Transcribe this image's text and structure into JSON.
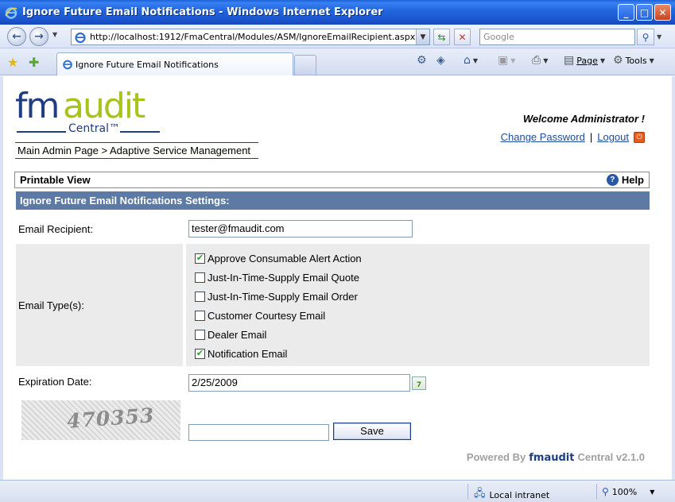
{
  "window": {
    "title": "Ignore Future Email Notifications - Windows Internet Explorer",
    "minimize_icon": "minimize-icon",
    "maximize_icon": "maximize-icon",
    "close_icon": "close-icon"
  },
  "addressbar": {
    "url": "http://localhost:1912/FmaCentral/Modules/ASM/IgnoreEmailRecipient.aspx?EmailID=",
    "search_placeholder": "Google"
  },
  "tabs": [
    {
      "label": "Ignore Future Email Notifications"
    }
  ],
  "commandbar": {
    "page_label": "Page",
    "tools_label": "Tools"
  },
  "header": {
    "logo_fm": "fm",
    "logo_audit": "audit",
    "logo_central": "Central™",
    "welcome": "Welcome Administrator !",
    "change_password": "Change Password",
    "separator": "|",
    "logout": "Logout",
    "breadcrumb": "Main Admin Page  >  Adaptive Service Management"
  },
  "toolbar": {
    "printable_view": "Printable View",
    "help": "Help"
  },
  "form": {
    "section_title": "Ignore Future Email Notifications Settings:",
    "email_label": "Email Recipient:",
    "email_value": "tester@fmaudit.com",
    "types_label": "Email Type(s):",
    "email_types": [
      {
        "label": "Approve Consumable Alert Action",
        "checked": true
      },
      {
        "label": "Just-In-Time-Supply Email Quote",
        "checked": false
      },
      {
        "label": "Just-In-Time-Supply Email Order",
        "checked": false
      },
      {
        "label": "Customer Courtesy Email",
        "checked": false
      },
      {
        "label": "Dealer Email",
        "checked": false
      },
      {
        "label": "Notification Email",
        "checked": true
      }
    ],
    "expiration_label": "Expiration Date:",
    "expiration_value": "2/25/2009",
    "captcha_text": "470353",
    "captcha_input_value": "",
    "save_label": "Save"
  },
  "footer": {
    "powered_by": "Powered By",
    "brand_fm": "fm",
    "brand_audit": "audit",
    "brand_suffix": "Central v2.1.0"
  },
  "statusbar": {
    "zone": "Local intranet",
    "zoom": "100%"
  },
  "colors": {
    "section_header": "#5c7aa3",
    "brand_blue": "#1e3d82",
    "brand_green": "#a7c31c",
    "link": "#1d4d9a"
  }
}
